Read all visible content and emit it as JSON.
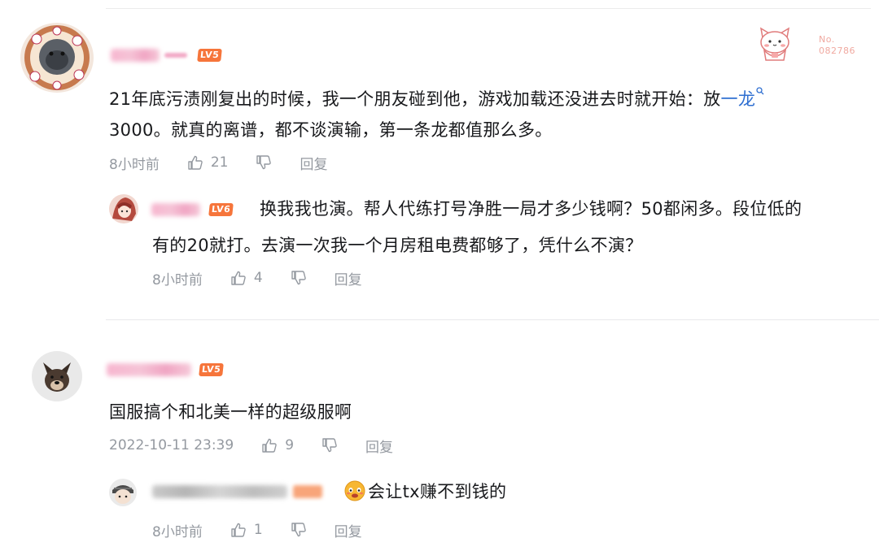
{
  "decoration": {
    "no_label": "No.",
    "no_number": "082786"
  },
  "comments": [
    {
      "level": "LV5",
      "text_line1": "21年底污渍刚复出的时候，我一个朋友碰到他，游戏加载还没进去时就开始：放",
      "text_link": "一龙",
      "text_line2": "3000。就真的离谱，都不谈演输，第一条龙都值那么多。",
      "time": "8小时前",
      "likes": "21",
      "reply_label": "回复",
      "replies": [
        {
          "level": "LV6",
          "text_line1": "换我我也演。帮人代练打号净胜一局才多少钱啊？50都闲多。段位低的",
          "text_line2": "有的20就打。去演一次我一个月房租电费都够了，凭什么不演？",
          "time": "8小时前",
          "likes": "4",
          "reply_label": "回复"
        }
      ]
    },
    {
      "level": "LV5",
      "text_line1": "国服搞个和北美一样的超级服啊",
      "time": "2022-10-11 23:39",
      "likes": "9",
      "reply_label": "回复",
      "replies": [
        {
          "text_line1": "会让tx赚不到钱的",
          "time": "8小时前",
          "likes": "1",
          "reply_label": "回复"
        }
      ]
    }
  ],
  "colors": {
    "text": "#18191c",
    "meta": "#9499a0",
    "link": "#2f6fd1",
    "level_badge": "#f6753b",
    "name_blur": "#f5b8cf"
  }
}
